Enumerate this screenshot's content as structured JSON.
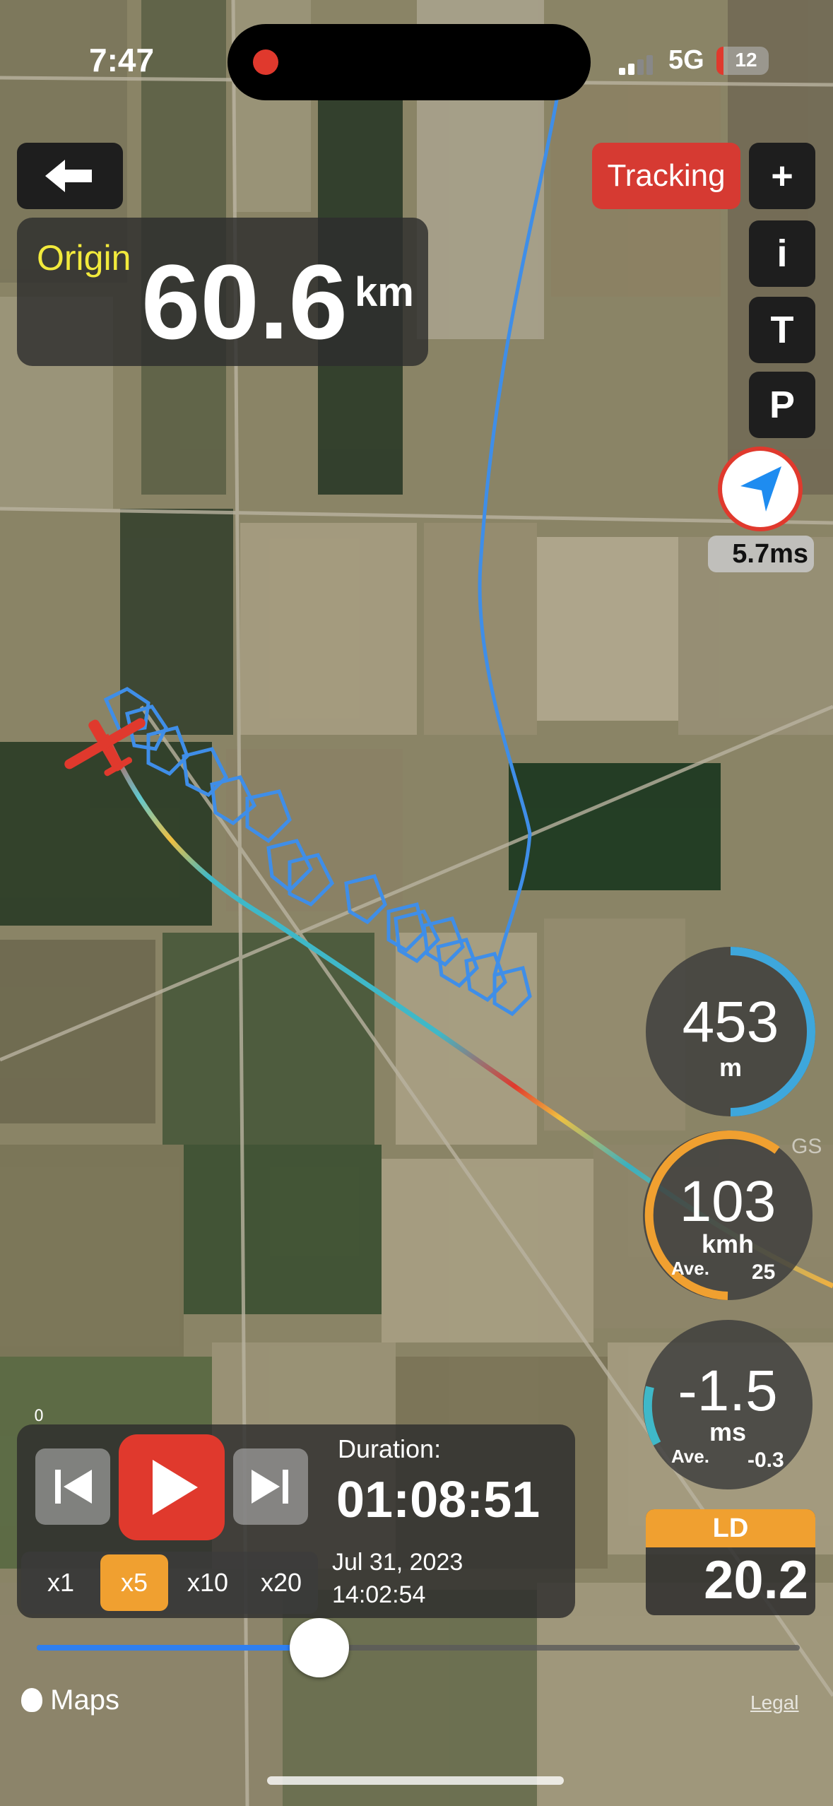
{
  "status_bar": {
    "time": "7:47",
    "network": "5G",
    "battery": "12"
  },
  "origin": {
    "label": "Origin",
    "value": "60.6",
    "unit": "km"
  },
  "tracking_button": "Tracking",
  "side_buttons": {
    "plus": "+",
    "info": "i",
    "t": "T",
    "p": "P"
  },
  "wind": {
    "value": "5.7ms",
    "accent": "#e0392d",
    "arrow_color": "#1e8cf0"
  },
  "altitude": {
    "value": "453",
    "unit": "m",
    "fraction": 0.5
  },
  "ground_speed": {
    "tag": "GS",
    "value": "103",
    "unit": "kmh",
    "avg_label": "Ave.",
    "avg_value": "25",
    "fraction": 0.6
  },
  "vario": {
    "value": "-1.5",
    "unit": "ms",
    "avg_label": "Ave.",
    "avg_value": "-0.3",
    "fraction": 0.1
  },
  "ld": {
    "label": "LD",
    "value": "20.2"
  },
  "playback": {
    "small_label": "0",
    "duration_label": "Duration:",
    "duration_value": "01:08:51",
    "date": "Jul 31, 2023",
    "time": "14:02:54",
    "speeds": [
      "x1",
      "x5",
      "x10",
      "x20"
    ],
    "active_speed": "x5",
    "progress": 0.37
  },
  "footer": {
    "maps_label": "Maps",
    "legal": "Legal"
  },
  "colors": {
    "accent_red": "#e0392d",
    "accent_orange": "#f0a030",
    "track_blue": "#3f8ee8",
    "gauge_blue": "#3ea7dc"
  }
}
